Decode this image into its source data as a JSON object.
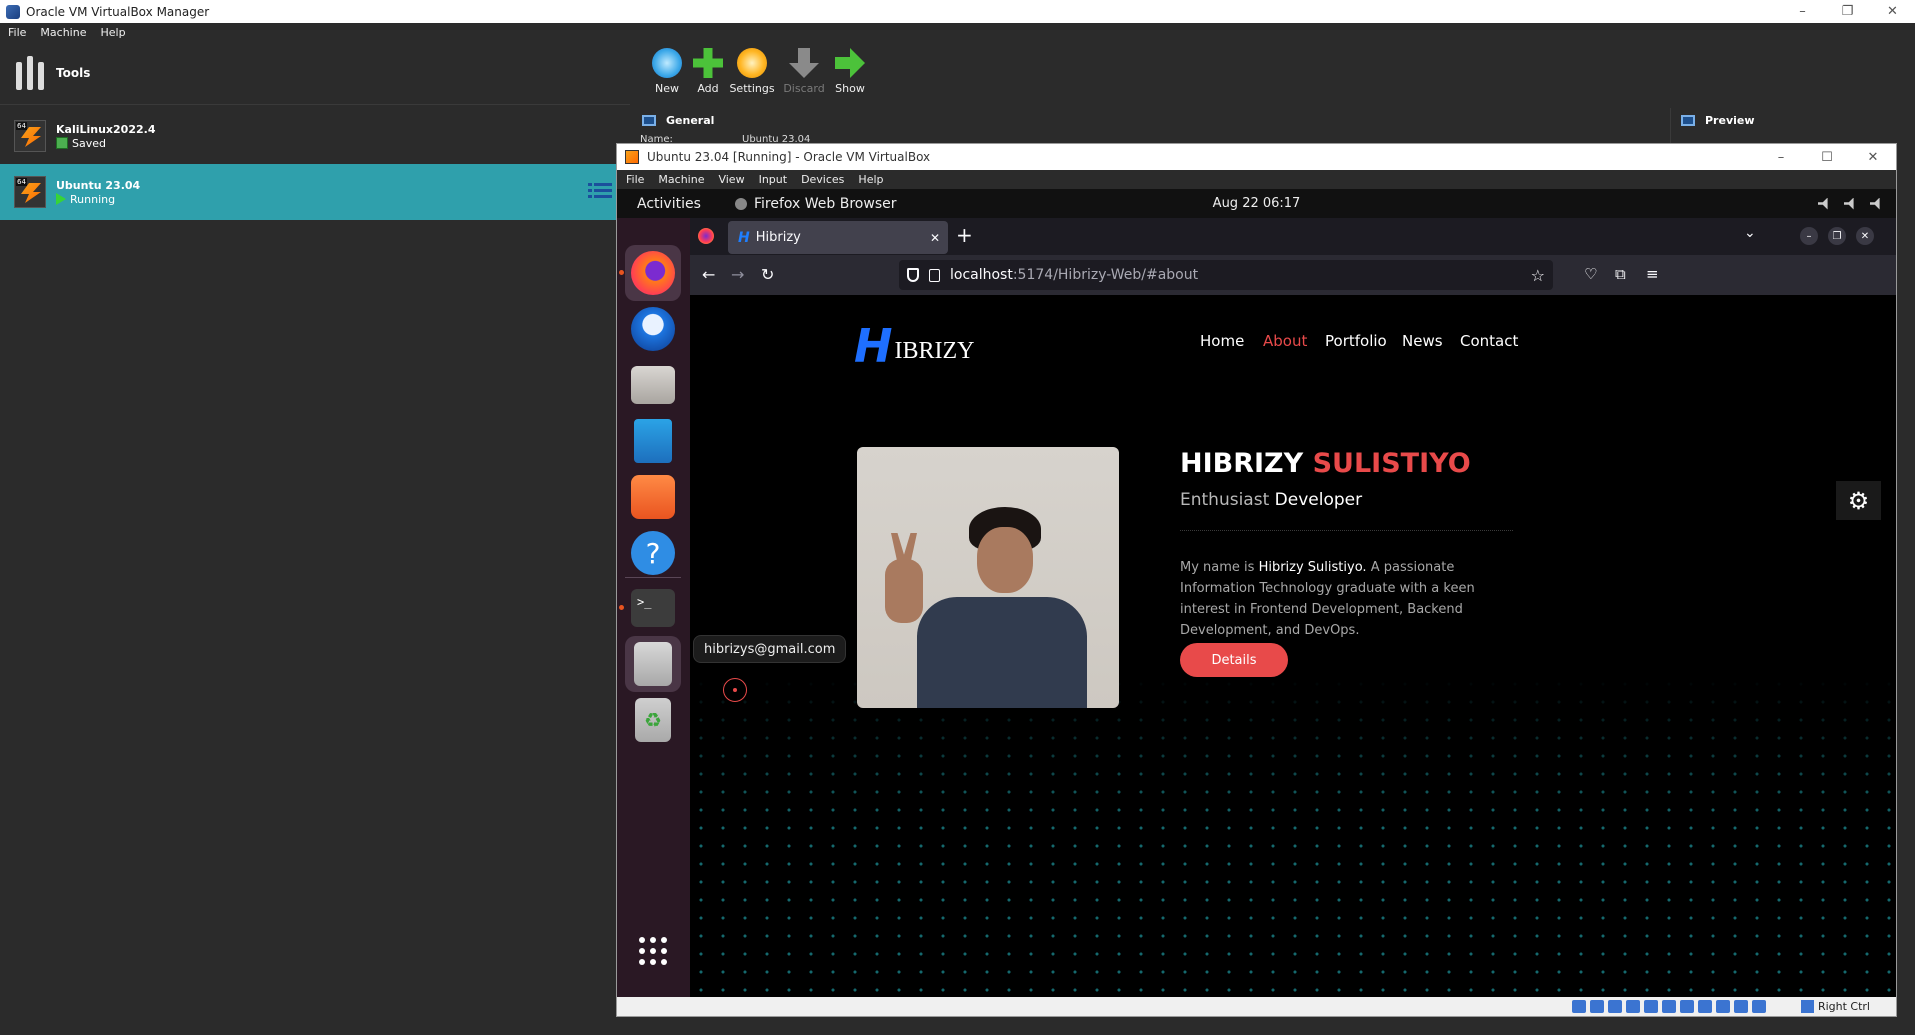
{
  "manager": {
    "title": "Oracle VM VirtualBox Manager",
    "menu": [
      "File",
      "Machine",
      "Help"
    ],
    "tools_label": "Tools",
    "vms": [
      {
        "name": "KaliLinux2022.4",
        "state": "Saved",
        "badge": "64"
      },
      {
        "name": "Ubuntu 23.04",
        "state": "Running",
        "badge": "64"
      }
    ],
    "toolbar": {
      "new": "New",
      "add": "Add",
      "settings": "Settings",
      "discard": "Discard",
      "show": "Show"
    },
    "details": {
      "general": "General",
      "preview": "Preview",
      "name_label": "Name:",
      "name_value": "Ubuntu 23.04"
    },
    "window_controls": {
      "minimize": "–",
      "restore": "❐",
      "close": "✕"
    }
  },
  "vm_window": {
    "title": "Ubuntu 23.04 [Running] - Oracle VM VirtualBox",
    "menu": [
      "File",
      "Machine",
      "View",
      "Input",
      "Devices",
      "Help"
    ],
    "status_host_key": "Right Ctrl"
  },
  "gnome": {
    "activities": "Activities",
    "app_name": "Firefox Web Browser",
    "clock": "Aug 22  06:17"
  },
  "dock": {
    "icons": [
      "firefox-icon",
      "thunderbird-icon",
      "files-icon",
      "libreoffice-writer-icon",
      "app-center-icon",
      "help-icon",
      "terminal-icon",
      "disks-icon",
      "trash-icon",
      "show-apps-icon"
    ],
    "terminal_glyph": ">_",
    "help_glyph": "?"
  },
  "firefox": {
    "tab_title": "Hibrizy",
    "tab_favicon": "H",
    "url_host": "localhost",
    "url_path": ":5174/Hibrizy-Web/#about"
  },
  "site": {
    "logo_mark": "H",
    "logo_text": "IBRIZY",
    "nav": [
      "Home",
      "About",
      "Portfolio",
      "News",
      "Contact"
    ],
    "active_nav": "About",
    "name_first": "HIBRIZY",
    "name_last": "SULISTIYO",
    "role_prefix": "Enthusiast",
    "role_main": "Developer",
    "desc_pre": "My name is ",
    "desc_name": "Hibrizy Sulistiyo.",
    "desc_post": " A passionate Information Technology graduate with a keen interest in Frontend Development, Backend Development, and DevOps.",
    "details_button": "Details",
    "email": "hibrizys@gmail.com",
    "colors": {
      "accent": "#e84a4a",
      "logo_blue": "#1e6fff",
      "particles": "#28c8d2"
    }
  }
}
